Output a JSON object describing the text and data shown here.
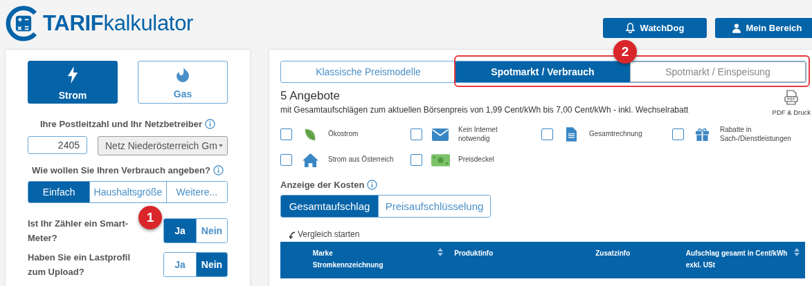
{
  "header": {
    "logo": {
      "strong": "TARIF",
      "rest": "kalkulator"
    },
    "buttons": [
      {
        "label": "WatchDog",
        "kind": "bell"
      },
      {
        "label": "Mein Bereich",
        "kind": "user"
      }
    ]
  },
  "sidebar": {
    "energy_types": [
      {
        "label": "Strom",
        "kind": "bolt",
        "selected": true
      },
      {
        "label": "Gas",
        "kind": "flame",
        "selected": false
      }
    ],
    "location_label": "Ihre Postleitzahl und Ihr Netzbetreiber",
    "postcode": "2405",
    "grid_operator": "Netz Niederösterreich Gm",
    "usage_label": "Wie wollen Sie Ihren Verbrauch angeben?",
    "usage_modes": [
      {
        "label": "Einfach",
        "selected": true
      },
      {
        "label": "Haushaltsgröße",
        "selected": false
      },
      {
        "label": "Weitere...",
        "selected": false
      }
    ],
    "questions": [
      {
        "label": "Ist Ihr Zähler ein Smart-Meter?",
        "options": [
          {
            "label": "Ja",
            "selected": true
          },
          {
            "label": "Nein",
            "selected": false
          }
        ]
      },
      {
        "label": "Haben Sie ein Lastprofil zum Upload?",
        "options": [
          {
            "label": "Ja",
            "selected": false
          },
          {
            "label": "Nein",
            "selected": true
          }
        ]
      }
    ]
  },
  "main": {
    "tabs": [
      {
        "label": "Klassische Preismodelle",
        "selected": false
      },
      {
        "label": "Spotmarkt / Verbrauch",
        "selected": true
      },
      {
        "label": "Spotmarkt / Einspeisung",
        "selected": false
      }
    ],
    "offers_title": "5 Angebote",
    "offers_subtitle": "mit Gesamtaufschlägen zum aktuellen Börsenpreis von 1,99 Cent/kWh bis 7,00 Cent/kWh - inkl. Wechselrabatt",
    "pdf_label": "PDF & Druck",
    "filters": [
      {
        "label": "Ökostrom",
        "kind": "leaf",
        "checked": false
      },
      {
        "label": "Kein Internet notwendig",
        "kind": "envelope",
        "checked": false
      },
      {
        "label": "Gesamtrechnung",
        "kind": "document",
        "checked": false
      },
      {
        "label": "Rabatte in Sach-/Dienstleistungen",
        "kind": "gift",
        "checked": false
      },
      {
        "label": "Strom aus Österreich",
        "kind": "house",
        "checked": false
      },
      {
        "label": "Preisdeckel",
        "kind": "money",
        "checked": false
      }
    ],
    "costs_label": "Anzeige der Kosten",
    "cost_modes": [
      {
        "label": "Gesamtaufschlag",
        "selected": true
      },
      {
        "label": "Preisaufschlüsselung",
        "selected": false
      }
    ],
    "compare_label": "Vergleich starten",
    "table": {
      "columns": [
        {
          "label": "Marke\nStromkennzeichnung",
          "sortable": true
        },
        {
          "label": "Produktinfo",
          "sortable": false
        },
        {
          "label": "Zusatzinfo",
          "sortable": false
        },
        {
          "label": "Aufschlag gesamt in Cent/kWh\nexkl. USt",
          "sortable": true
        }
      ]
    }
  },
  "annotations": [
    {
      "label": "1"
    },
    {
      "label": "2"
    }
  ]
}
